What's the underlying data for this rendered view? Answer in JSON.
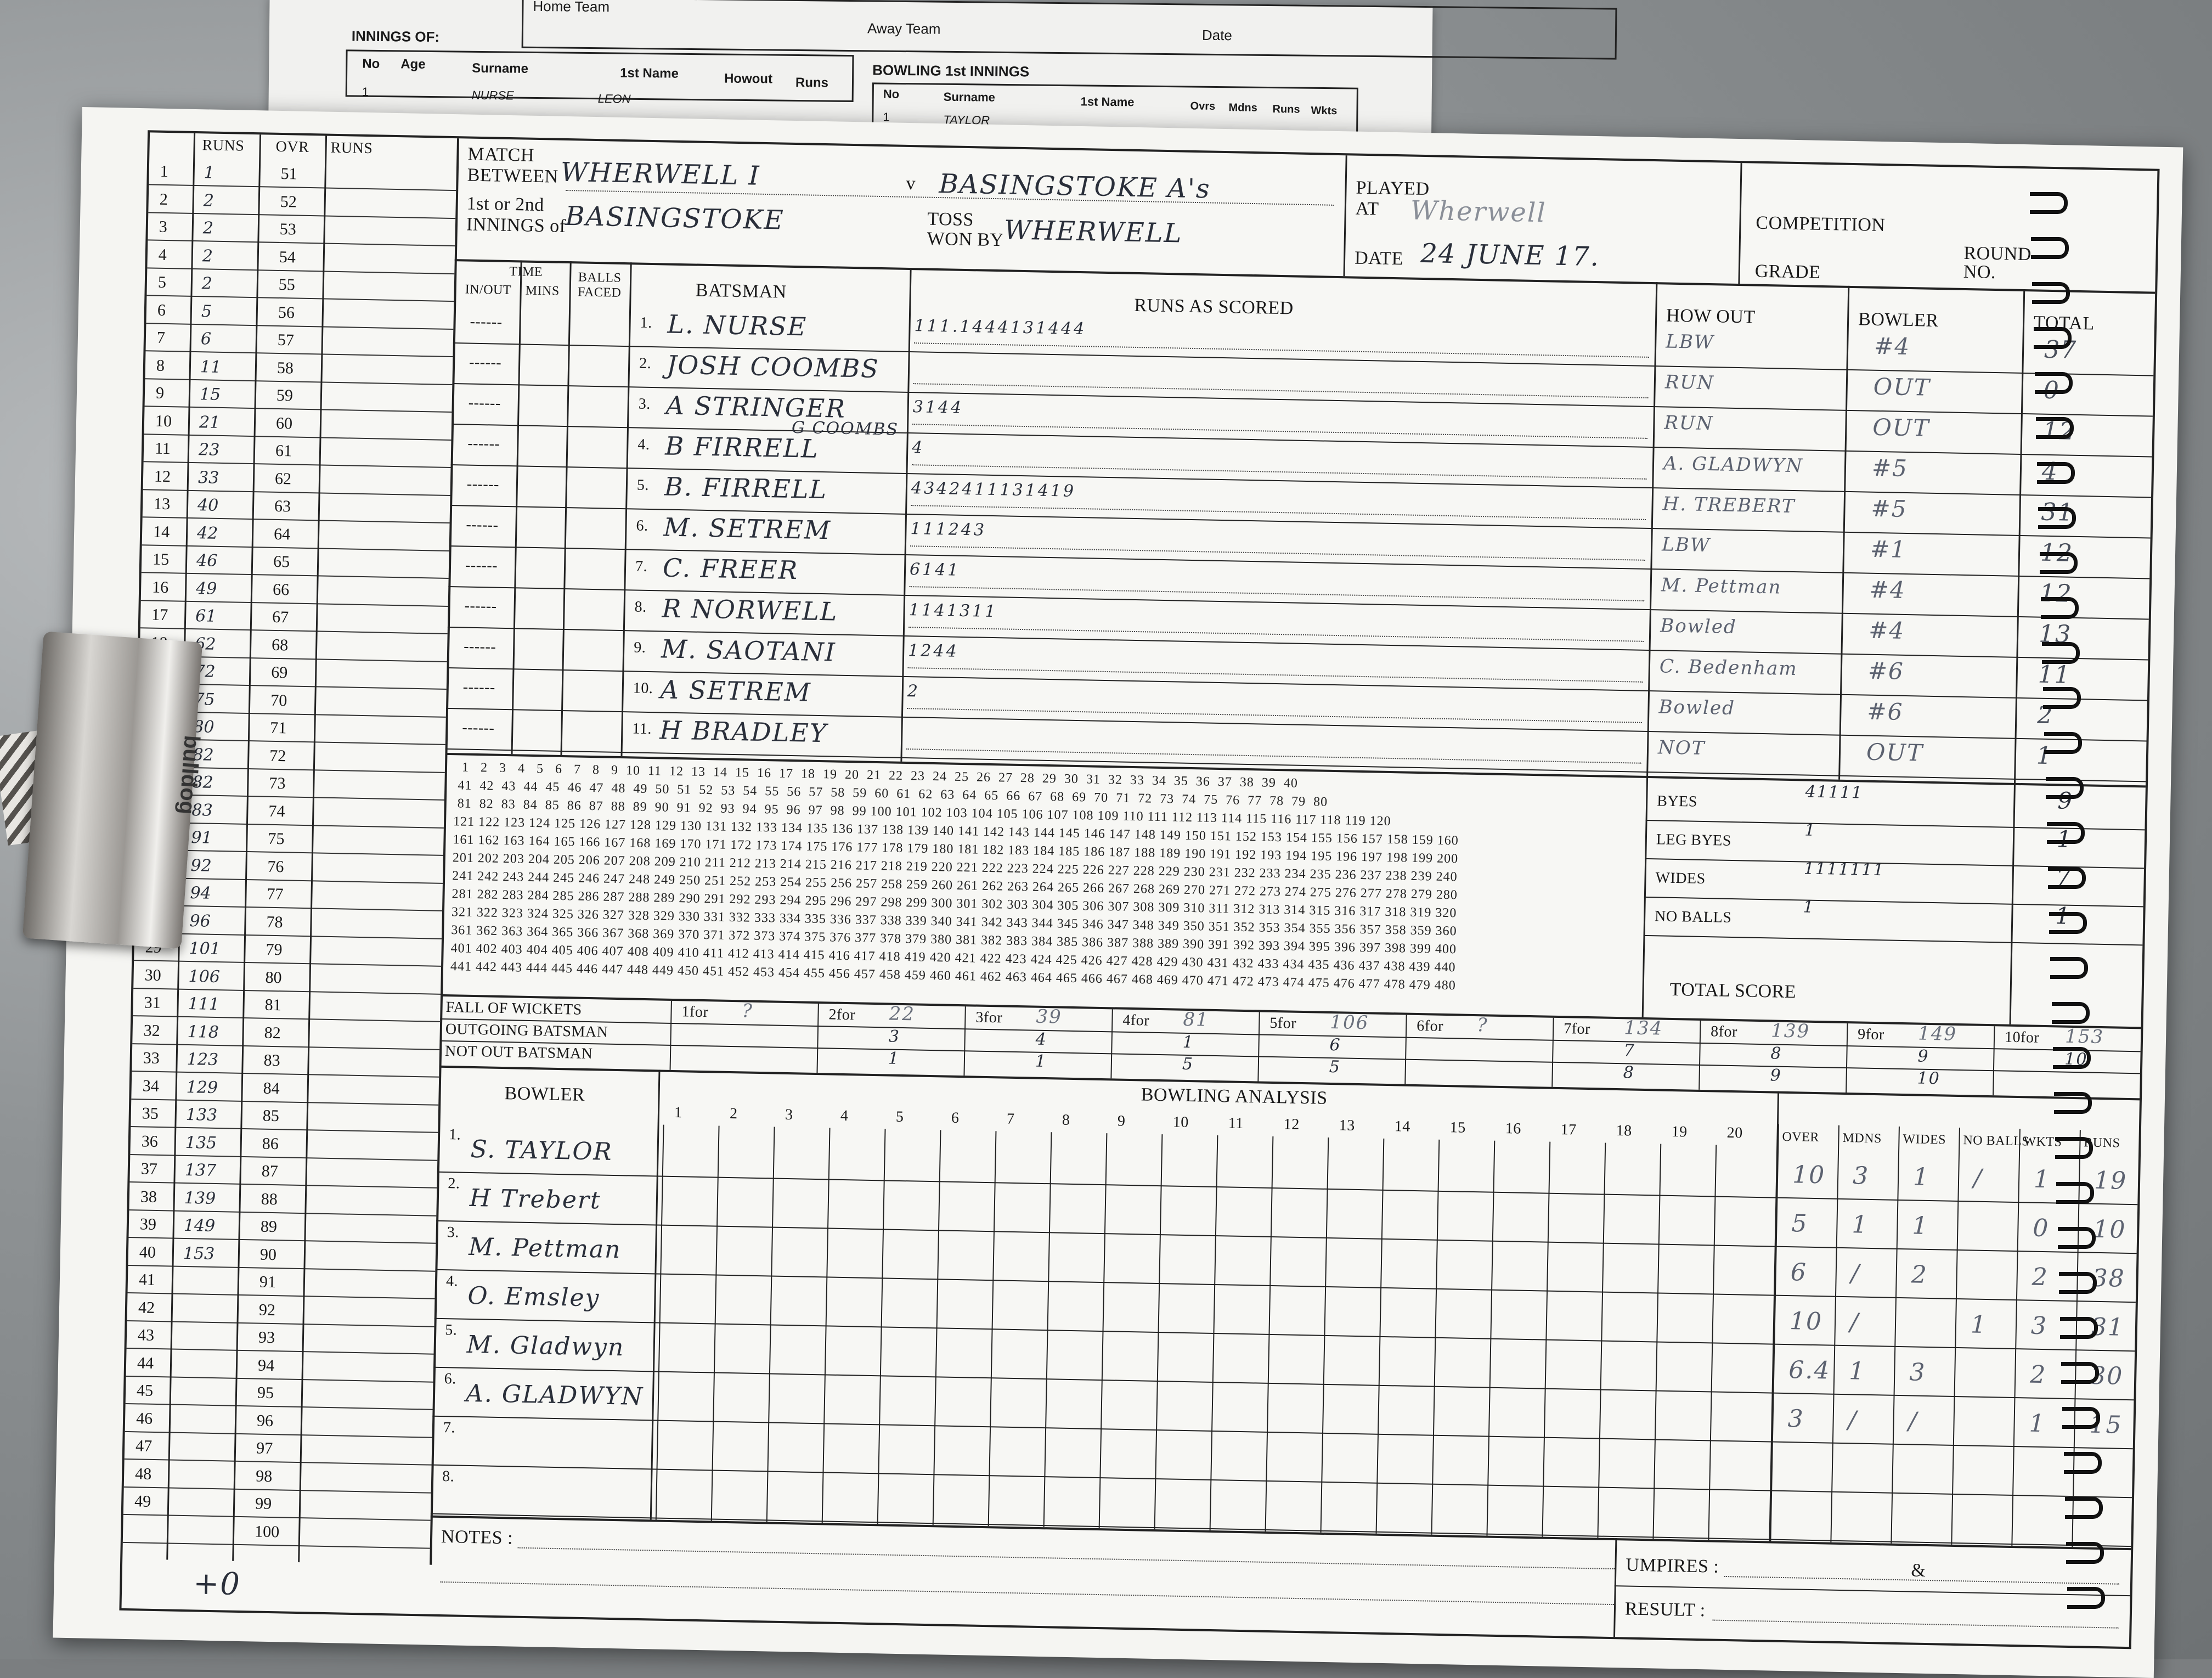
{
  "back_sheet": {
    "home_team": "Home Team",
    "away_team": "Away Team",
    "date_label": "Date",
    "innings_of": "INNINGS OF:",
    "headers": [
      "No",
      "Age",
      "Surname",
      "1st Name",
      "Howout",
      "Runs"
    ],
    "bowling_title": "BOWLING 1st INNINGS",
    "bowling_headers": [
      "No",
      "Surname",
      "1st Name",
      "Ovrs",
      "Mdns",
      "Runs",
      "Wkts"
    ],
    "row1": {
      "no": "1",
      "surname": "NURSE",
      "first": "LEON"
    },
    "bowl_row1": {
      "no": "1",
      "surname": "TAYLOR"
    }
  },
  "header": {
    "match_label": "MATCH",
    "between_label": "BETWEEN",
    "team_home": "WHERWELL I",
    "v_label": "v",
    "team_away": "BASINGSTOKE A's",
    "innings_label_1": "1st or 2nd",
    "innings_label_2": "INNINGS of",
    "innings_of": "BASINGSTOKE",
    "toss_label": "TOSS",
    "won_by_label": "WON BY",
    "toss_won_by": "WHERWELL",
    "played_label": "PLAYED",
    "at_label": "AT",
    "venue": "Wherwell",
    "date_label": "DATE",
    "date": "24 JUNE 17.",
    "competition_label": "COMPETITION",
    "grade_label": "GRADE",
    "round_label": "ROUND",
    "no_label": "NO."
  },
  "runs_column": {
    "headers": [
      "RUNS",
      "OVR",
      "RUNS"
    ],
    "rows": [
      {
        "ovr": "1",
        "runs": "1",
        "ovr2": "51"
      },
      {
        "ovr": "2",
        "runs": "2",
        "ovr2": "52"
      },
      {
        "ovr": "3",
        "runs": "2",
        "ovr2": "53"
      },
      {
        "ovr": "4",
        "runs": "2",
        "ovr2": "54"
      },
      {
        "ovr": "5",
        "runs": "2",
        "ovr2": "55"
      },
      {
        "ovr": "6",
        "runs": "5",
        "ovr2": "56"
      },
      {
        "ovr": "7",
        "runs": "6",
        "ovr2": "57"
      },
      {
        "ovr": "8",
        "runs": "11",
        "ovr2": "58"
      },
      {
        "ovr": "9",
        "runs": "15",
        "ovr2": "59"
      },
      {
        "ovr": "10",
        "runs": "21",
        "ovr2": "60"
      },
      {
        "ovr": "11",
        "runs": "23",
        "ovr2": "61"
      },
      {
        "ovr": "12",
        "runs": "33",
        "ovr2": "62"
      },
      {
        "ovr": "13",
        "runs": "40",
        "ovr2": "63"
      },
      {
        "ovr": "14",
        "runs": "42",
        "ovr2": "64"
      },
      {
        "ovr": "15",
        "runs": "46",
        "ovr2": "65"
      },
      {
        "ovr": "16",
        "runs": "49",
        "ovr2": "66"
      },
      {
        "ovr": "17",
        "runs": "61",
        "ovr2": "67"
      },
      {
        "ovr": "18",
        "runs": "62",
        "ovr2": "68"
      },
      {
        "ovr": "19",
        "runs": "72",
        "ovr2": "69"
      },
      {
        "ovr": "20",
        "runs": "75",
        "ovr2": "70"
      },
      {
        "ovr": "21",
        "runs": "80",
        "ovr2": "71"
      },
      {
        "ovr": "22",
        "runs": "82",
        "ovr2": "72"
      },
      {
        "ovr": "23",
        "runs": "82",
        "ovr2": "73"
      },
      {
        "ovr": "24",
        "runs": "83",
        "ovr2": "74"
      },
      {
        "ovr": "25",
        "runs": "91",
        "ovr2": "75"
      },
      {
        "ovr": "26",
        "runs": "92",
        "ovr2": "76"
      },
      {
        "ovr": "27",
        "runs": "94",
        "ovr2": "77"
      },
      {
        "ovr": "28",
        "runs": "96",
        "ovr2": "78"
      },
      {
        "ovr": "29",
        "runs": "101",
        "ovr2": "79"
      },
      {
        "ovr": "30",
        "runs": "106",
        "ovr2": "80"
      },
      {
        "ovr": "31",
        "runs": "111",
        "ovr2": "81"
      },
      {
        "ovr": "32",
        "runs": "118",
        "ovr2": "82"
      },
      {
        "ovr": "33",
        "runs": "123",
        "ovr2": "83"
      },
      {
        "ovr": "34",
        "runs": "129",
        "ovr2": "84"
      },
      {
        "ovr": "35",
        "runs": "133",
        "ovr2": "85"
      },
      {
        "ovr": "36",
        "runs": "135",
        "ovr2": "86"
      },
      {
        "ovr": "37",
        "runs": "137",
        "ovr2": "87"
      },
      {
        "ovr": "38",
        "runs": "139",
        "ovr2": "88"
      },
      {
        "ovr": "39",
        "runs": "149",
        "ovr2": "89"
      },
      {
        "ovr": "40",
        "runs": "153",
        "ovr2": "90"
      },
      {
        "ovr": "41",
        "runs": "",
        "ovr2": "91"
      },
      {
        "ovr": "42",
        "runs": "",
        "ovr2": "92"
      },
      {
        "ovr": "43",
        "runs": "",
        "ovr2": "93"
      },
      {
        "ovr": "44",
        "runs": "",
        "ovr2": "94"
      },
      {
        "ovr": "45",
        "runs": "",
        "ovr2": "95"
      },
      {
        "ovr": "46",
        "runs": "",
        "ovr2": "96"
      },
      {
        "ovr": "47",
        "runs": "",
        "ovr2": "97"
      },
      {
        "ovr": "48",
        "runs": "",
        "ovr2": "98"
      },
      {
        "ovr": "49",
        "runs": "",
        "ovr2": "99"
      },
      {
        "ovr": "",
        "runs": "",
        "ovr2": "100"
      }
    ],
    "footnote": "+0"
  },
  "batting": {
    "time_label": "TIME",
    "in_out_label": "IN/OUT",
    "mins_label": "MINS",
    "balls_faced_label": "BALLS FACED",
    "batsman_label": "BATSMAN",
    "runs_as_scored_label": "RUNS AS SCORED",
    "how_out_label": "HOW OUT",
    "bowler_label": "BOWLER",
    "total_label": "TOTAL",
    "rows": [
      {
        "no": "1.",
        "name": "L. NURSE",
        "scored": "111.1444131444",
        "how_out": "LBW",
        "bowler": "#4",
        "total": "37"
      },
      {
        "no": "2.",
        "name": "JOSH COOMBS",
        "scored": "",
        "how_out": "RUN",
        "bowler": "OUT",
        "total": "0"
      },
      {
        "no": "3.",
        "name": "A STRINGER",
        "scored": "3144",
        "how_out": "RUN",
        "bowler": "OUT",
        "total": "12"
      },
      {
        "no": "4.",
        "name": "B FIRRELL",
        "alt": "G COOMBS",
        "scored": "4",
        "how_out": "A. GLADWYN",
        "bowler": "#5",
        "total": "4"
      },
      {
        "no": "5.",
        "name": "B. FIRRELL",
        "scored": "4342411131419",
        "how_out": "H. TREBERT",
        "bowler": "#5",
        "total": "31"
      },
      {
        "no": "6.",
        "name": "M. SETREM",
        "scored": "111243",
        "how_out": "LBW",
        "bowler": "#1",
        "total": "12"
      },
      {
        "no": "7.",
        "name": "C. FREER",
        "scored": "6141",
        "how_out": "M. Pettman",
        "bowler": "#4",
        "total": "12"
      },
      {
        "no": "8.",
        "name": "R NORWELL",
        "scored": "1141311",
        "how_out": "Bowled",
        "bowler": "#4",
        "total": "13"
      },
      {
        "no": "9.",
        "name": "M. SAOTANI",
        "scored": "1244",
        "how_out": "C. Bedenham",
        "bowler": "#6",
        "total": "11"
      },
      {
        "no": "10.",
        "name": "A SETREM",
        "scored": "2",
        "how_out": "Bowled",
        "bowler": "#6",
        "total": "2"
      },
      {
        "no": "11.",
        "name": "H BRADLEY",
        "scored": "",
        "how_out": "NOT",
        "bowler": "OUT",
        "total": "1"
      }
    ]
  },
  "extras": {
    "byes_label": "BYES",
    "byes_marks": "41111",
    "byes_total": "9",
    "leg_byes_label": "LEG BYES",
    "leg_byes_marks": "1",
    "leg_byes_total": "1",
    "wides_label": "WIDES",
    "wides_marks": "1111111",
    "wides_total": "7",
    "no_balls_label": "NO BALLS",
    "no_balls_marks": "1",
    "no_balls_total": "1",
    "total_score_label": "TOTAL SCORE"
  },
  "fall_of_wickets": {
    "fow_label": "FALL OF WICKETS",
    "outgoing_label": "OUTGOING BATSMAN",
    "not_out_label": "NOT OUT BATSMAN",
    "cols": [
      {
        "label": "1for",
        "score": "?",
        "out": "",
        "notout": ""
      },
      {
        "label": "2for",
        "score": "22",
        "out": "3",
        "notout": "1"
      },
      {
        "label": "3for",
        "score": "39",
        "out": "4",
        "notout": "1"
      },
      {
        "label": "4for",
        "score": "81",
        "out": "1",
        "notout": "5"
      },
      {
        "label": "5for",
        "score": "106",
        "out": "6",
        "notout": "5"
      },
      {
        "label": "6for",
        "score": "?",
        "out": "",
        "notout": ""
      },
      {
        "label": "7for",
        "score": "134",
        "out": "7",
        "notout": "8"
      },
      {
        "label": "8for",
        "score": "139",
        "out": "8",
        "notout": "9"
      },
      {
        "label": "9for",
        "score": "149",
        "out": "9",
        "notout": "10"
      },
      {
        "label": "10for",
        "score": "153",
        "out": "10",
        "notout": ""
      }
    ]
  },
  "bowling": {
    "title": "BOWLING ANALYSIS",
    "bowler_label": "BOWLER",
    "over_numbers": [
      "1",
      "2",
      "3",
      "4",
      "5",
      "6",
      "7",
      "8",
      "9",
      "10",
      "11",
      "12",
      "13",
      "14",
      "15",
      "16",
      "17",
      "18",
      "19",
      "20"
    ],
    "summary_headers": [
      "OVER",
      "MDNS",
      "WIDES",
      "NO BALLS",
      "WKTS",
      "RUNS"
    ],
    "rows": [
      {
        "no": "1.",
        "name": "S. TAYLOR",
        "over": "10",
        "mdns": "3",
        "wides": "1",
        "no_balls": "/",
        "wkts": "1",
        "runs": "19"
      },
      {
        "no": "2.",
        "name": "H Trebert",
        "over": "5",
        "mdns": "1",
        "wides": "1",
        "no_balls": "",
        "wkts": "0",
        "runs": "10"
      },
      {
        "no": "3.",
        "name": "M. Pettman",
        "over": "6",
        "mdns": "/",
        "wides": "2",
        "no_balls": "",
        "wkts": "2",
        "runs": "38"
      },
      {
        "no": "4.",
        "name": "O. Emsley",
        "over": "10",
        "mdns": "/",
        "wides": "",
        "no_balls": "1",
        "wkts": "3",
        "runs": "31"
      },
      {
        "no": "5.",
        "name": "M. Gladwyn",
        "over": "6.4",
        "mdns": "1",
        "wides": "3",
        "no_balls": "",
        "wkts": "2",
        "runs": "30"
      },
      {
        "no": "6.",
        "name": "A. GLADWYN",
        "over": "3",
        "mdns": "/",
        "wides": "/",
        "no_balls": "",
        "wkts": "1",
        "runs": "15"
      },
      {
        "no": "7.",
        "name": "",
        "over": "",
        "mdns": "",
        "wides": "",
        "no_balls": "",
        "wkts": "",
        "runs": ""
      },
      {
        "no": "8.",
        "name": "",
        "over": "",
        "mdns": "",
        "wides": "",
        "no_balls": "",
        "wkts": "",
        "runs": ""
      }
    ]
  },
  "footer": {
    "notes_label": "NOTES :",
    "umpires_label": "UMPIRES :",
    "amp": "&",
    "result_label": "RESULT :"
  },
  "clip_brand": "bulldog"
}
